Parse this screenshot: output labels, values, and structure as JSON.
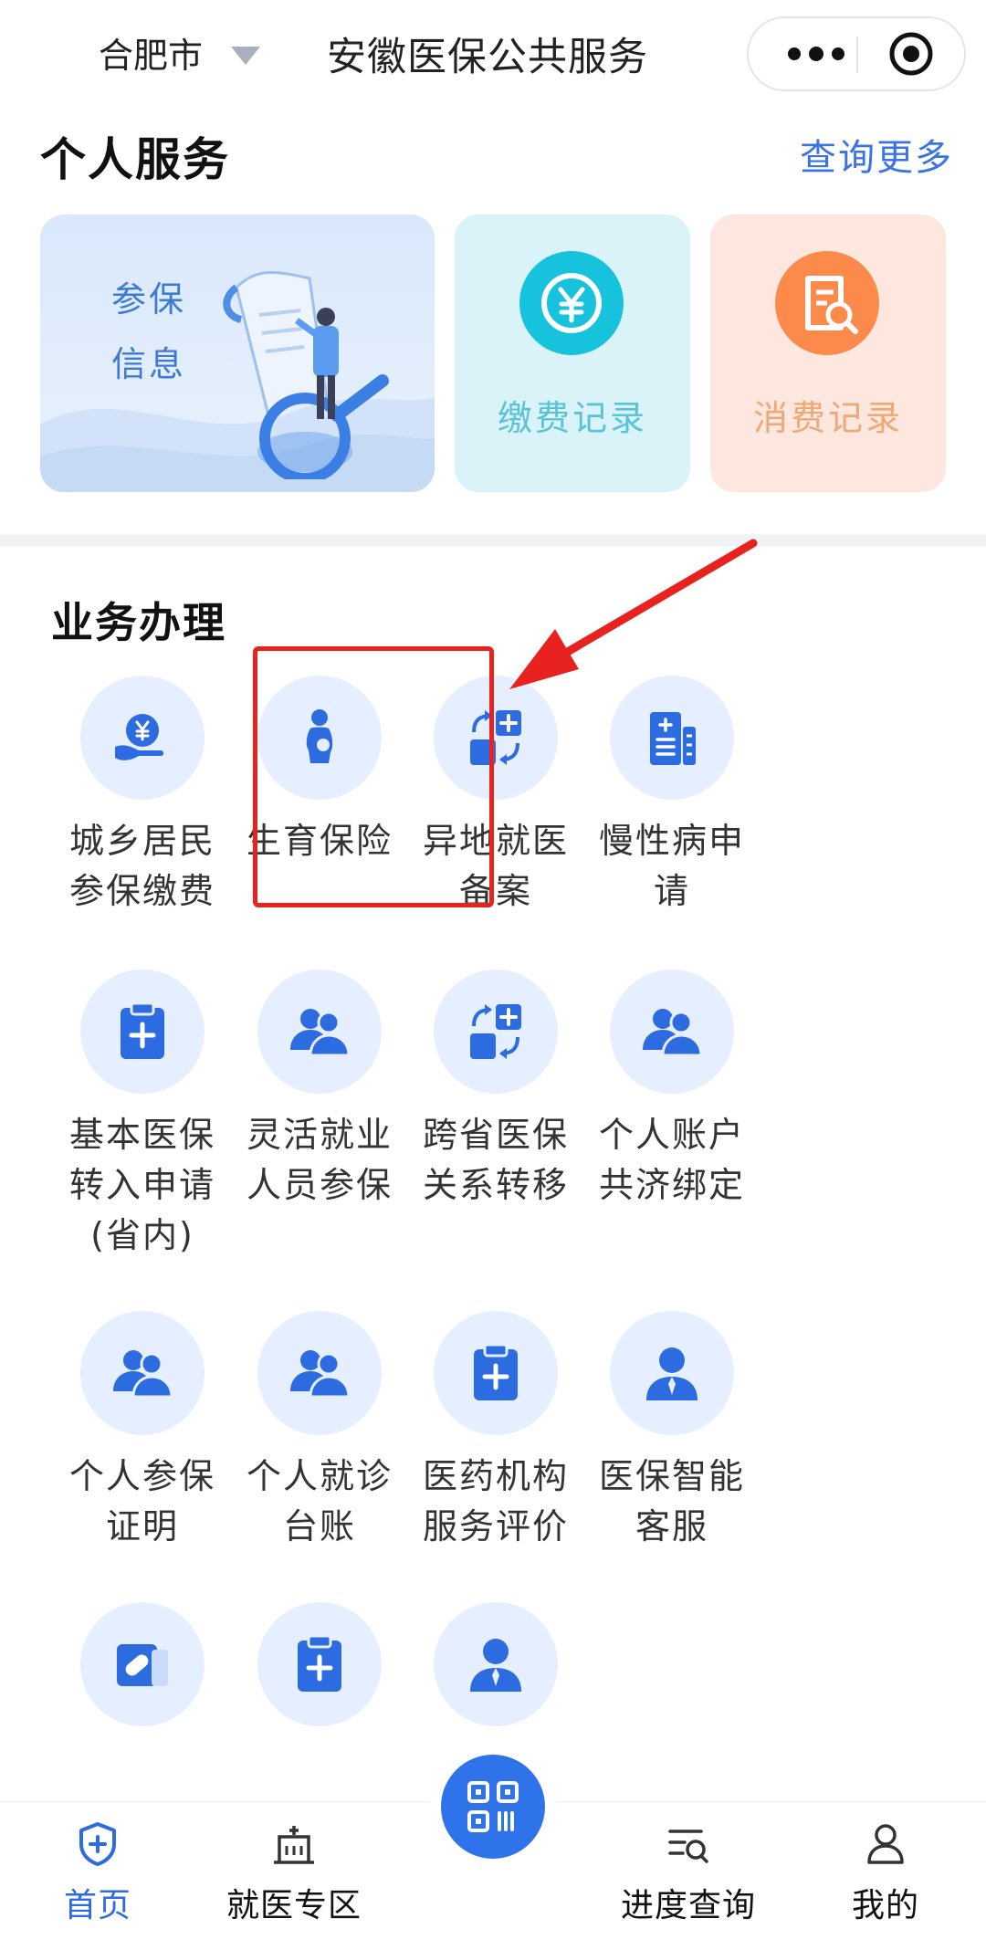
{
  "header": {
    "city": "合肥市",
    "title": "安徽医保公共服务"
  },
  "personal": {
    "title": "个人服务",
    "more": "查询更多",
    "info_line1": "参保",
    "info_line2": "信息",
    "pay_label": "缴费记录",
    "spend_label": "消费记录"
  },
  "business": {
    "title": "业务办理",
    "items": [
      {
        "label": "城乡居民\n参保缴费",
        "icon": "yuan-hand-icon"
      },
      {
        "label": "生育保险",
        "icon": "pregnant-icon"
      },
      {
        "label": "异地就医\n备案",
        "icon": "transfer-plus-icon"
      },
      {
        "label": "慢性病申\n请",
        "icon": "document-list-icon"
      },
      {
        "label": "基本医保\n转入申请\n(省内)",
        "icon": "clipboard-plus-icon"
      },
      {
        "label": "灵活就业\n人员参保",
        "icon": "users-icon"
      },
      {
        "label": "跨省医保\n关系转移",
        "icon": "transfer-plus-icon"
      },
      {
        "label": "个人账户\n共济绑定",
        "icon": "users-icon"
      },
      {
        "label": "个人参保\n证明",
        "icon": "users-icon"
      },
      {
        "label": "个人就诊\n台账",
        "icon": "users-icon"
      },
      {
        "label": "医药机构\n服务评价",
        "icon": "clipboard-plus-icon"
      },
      {
        "label": "医保智能\n客服",
        "icon": "agent-icon"
      },
      {
        "label": "",
        "icon": "pill-card-icon"
      },
      {
        "label": "",
        "icon": "clipboard-plus-icon"
      },
      {
        "label": "",
        "icon": "agent-icon"
      }
    ]
  },
  "nav": {
    "home": "首页",
    "medical": "就医专区",
    "progress": "进度查询",
    "mine": "我的"
  },
  "colors": {
    "accent": "#2f73ea",
    "icon_bg": "#e6efff",
    "highlight": "#e8231f",
    "arrow": "#e8231f"
  }
}
